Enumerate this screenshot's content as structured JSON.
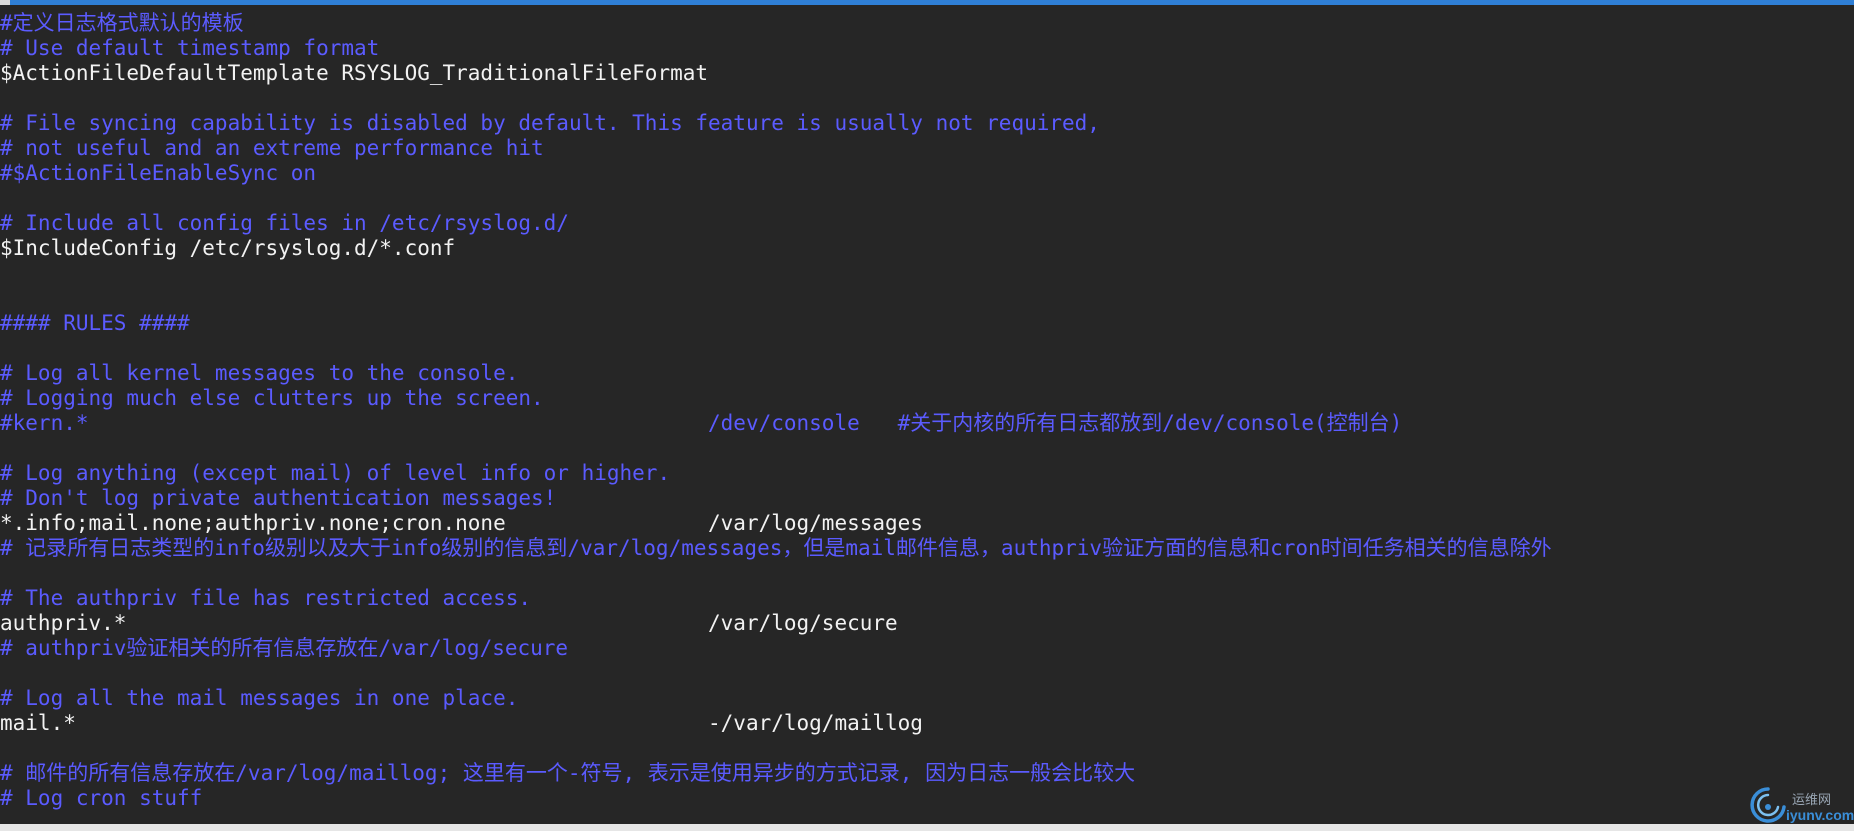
{
  "lines": [
    {
      "text": "#定义日志格式默认的模板",
      "kind": "comment"
    },
    {
      "text": "# Use default timestamp format",
      "kind": "comment"
    },
    {
      "text": "$ActionFileDefaultTemplate RSYSLOG_TraditionalFileFormat",
      "kind": "code"
    },
    {
      "text": "",
      "kind": "code"
    },
    {
      "text": "# File syncing capability is disabled by default. This feature is usually not required,",
      "kind": "comment"
    },
    {
      "text": "# not useful and an extreme performance hit",
      "kind": "comment"
    },
    {
      "text": "#$ActionFileEnableSync on",
      "kind": "comment"
    },
    {
      "text": "",
      "kind": "code"
    },
    {
      "text": "# Include all config files in /etc/rsyslog.d/",
      "kind": "comment"
    },
    {
      "text": "$IncludeConfig /etc/rsyslog.d/*.conf",
      "kind": "code"
    },
    {
      "text": "",
      "kind": "code"
    },
    {
      "text": "",
      "kind": "code"
    },
    {
      "text": "#### RULES ####",
      "kind": "comment"
    },
    {
      "text": "",
      "kind": "code"
    },
    {
      "text": "# Log all kernel messages to the console.",
      "kind": "comment"
    },
    {
      "text": "# Logging much else clutters up the screen.",
      "kind": "comment"
    },
    {
      "text": "#kern.*                                                 /dev/console   #关于内核的所有日志都放到/dev/console(控制台)",
      "kind": "comment"
    },
    {
      "text": "",
      "kind": "code"
    },
    {
      "text": "# Log anything (except mail) of level info or higher.",
      "kind": "comment"
    },
    {
      "text": "# Don't log private authentication messages!",
      "kind": "comment"
    },
    {
      "text": "*.info;mail.none;authpriv.none;cron.none                /var/log/messages",
      "kind": "code"
    },
    {
      "text": "# 记录所有日志类型的info级别以及大于info级别的信息到/var/log/messages，但是mail邮件信息，authpriv验证方面的信息和cron时间任务相关的信息除外",
      "kind": "comment"
    },
    {
      "text": "",
      "kind": "code"
    },
    {
      "text": "# The authpriv file has restricted access.",
      "kind": "comment"
    },
    {
      "text": "authpriv.*                                              /var/log/secure",
      "kind": "code"
    },
    {
      "text": "# authpriv验证相关的所有信息存放在/var/log/secure",
      "kind": "comment"
    },
    {
      "text": "",
      "kind": "code"
    },
    {
      "text": "# Log all the mail messages in one place.",
      "kind": "comment"
    },
    {
      "text": "mail.*                                                  -/var/log/maillog",
      "kind": "code"
    },
    {
      "text": "",
      "kind": "code"
    },
    {
      "text": "# 邮件的所有信息存放在/var/log/maillog; 这里有一个-符号, 表示是使用异步的方式记录, 因为日志一般会比较大",
      "kind": "comment"
    },
    {
      "text": "# Log cron stuff",
      "kind": "comment"
    }
  ],
  "watermark": {
    "top_text": "运维网",
    "bottom_text": "iyunv.com",
    "icon": "swirl-logo-icon"
  },
  "colors": {
    "background": "#262626",
    "comment": "#5b5bff",
    "code": "#f2f2f2",
    "accent_bar": "#2f7fd6"
  }
}
